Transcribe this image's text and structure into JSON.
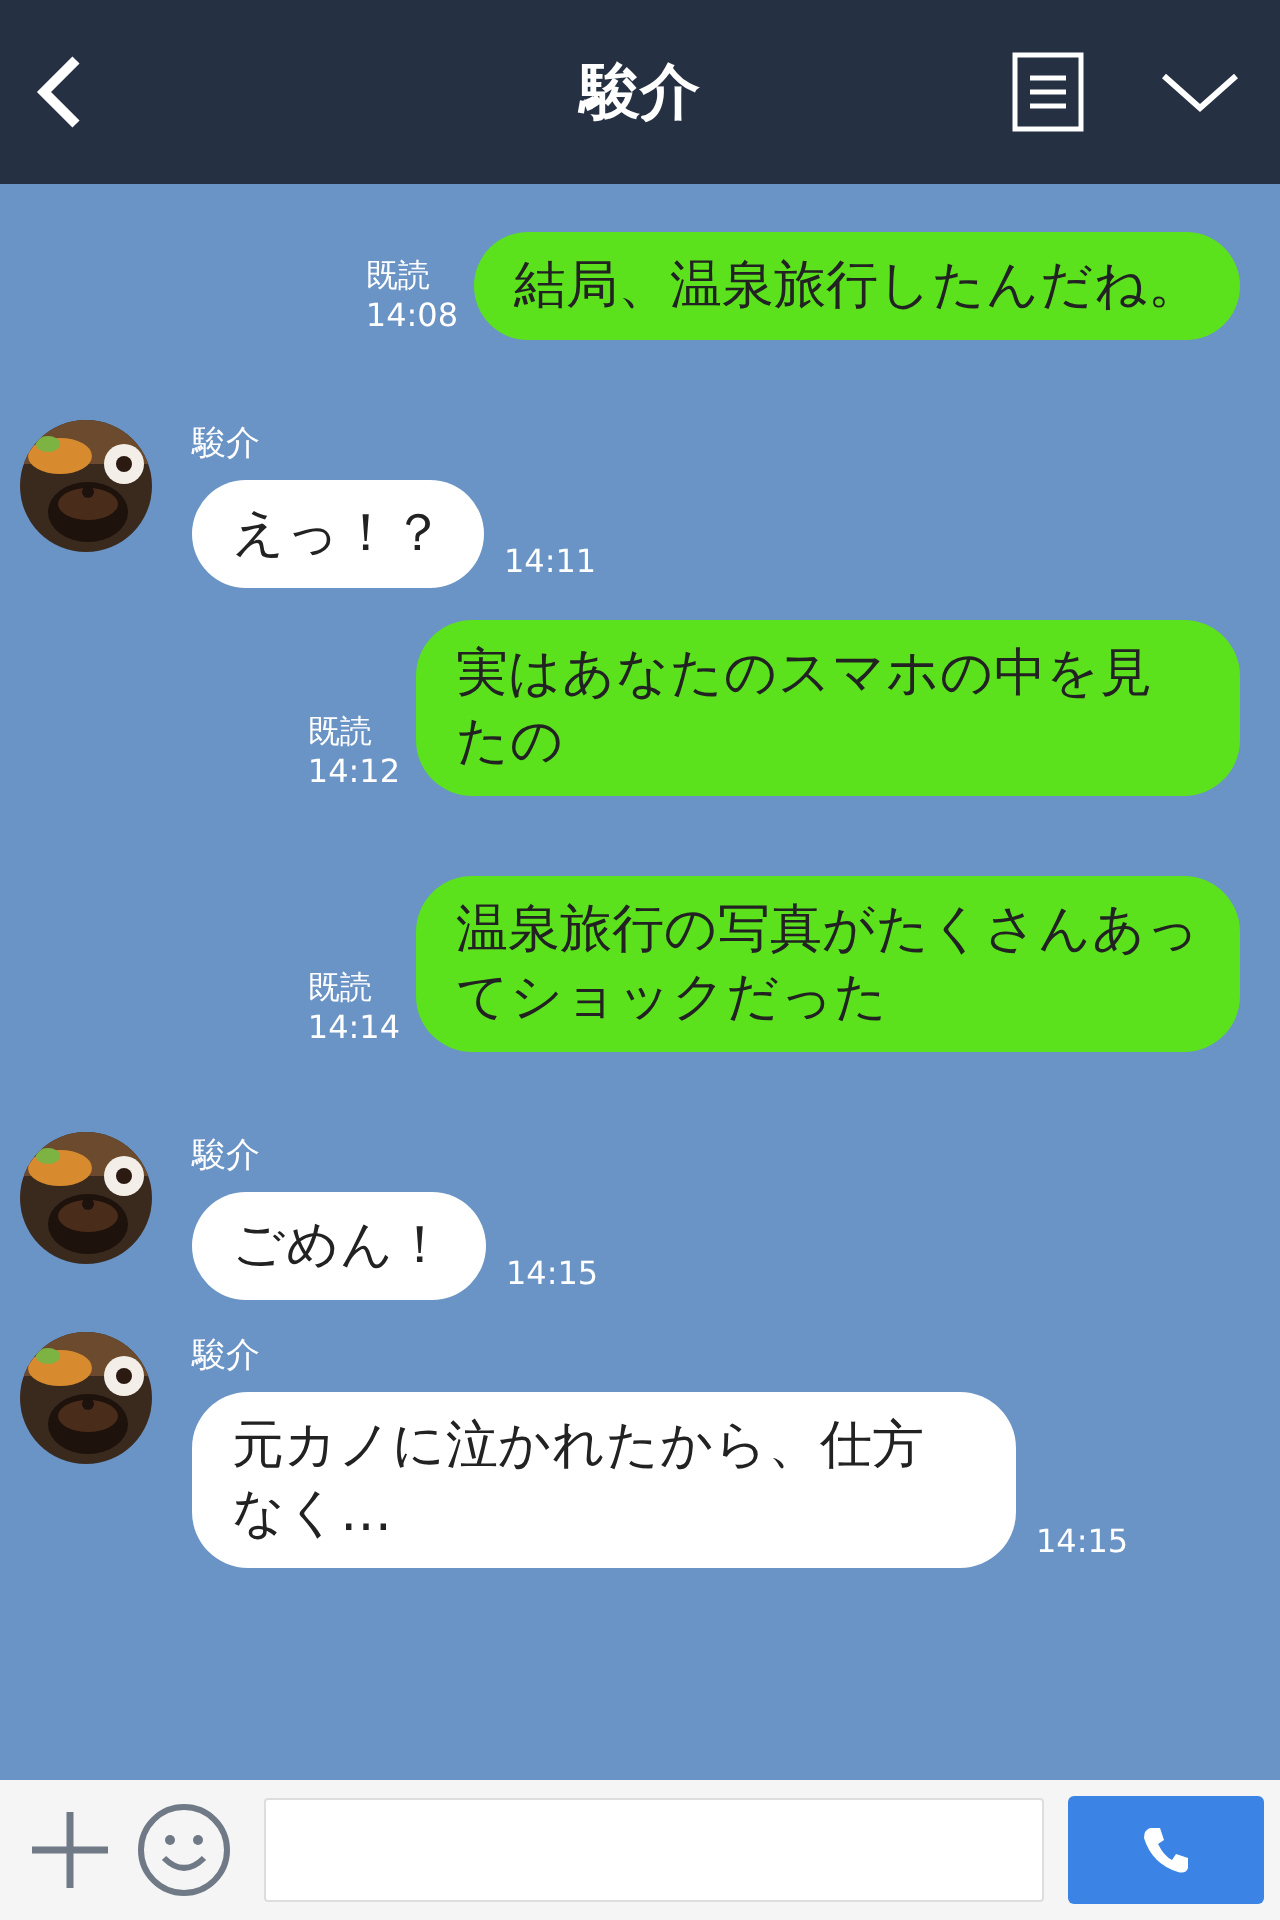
{
  "header": {
    "title": "駿介"
  },
  "messages": [
    {
      "kind": "sent",
      "text": "結局、温泉旅行したんだね。",
      "read": "既読",
      "time": "14:08"
    },
    {
      "kind": "received",
      "name": "駿介",
      "text": "えっ！？",
      "time": "14:11"
    },
    {
      "kind": "sent",
      "text": "実はあなたのスマホの中を見たの",
      "read": "既読",
      "time": "14:12"
    },
    {
      "kind": "sent",
      "text": "温泉旅行の写真がたくさんあってショックだった",
      "read": "既読",
      "time": "14:14"
    },
    {
      "kind": "received",
      "name": "駿介",
      "text": "ごめん！",
      "time": "14:15"
    },
    {
      "kind": "received",
      "name": "駿介",
      "text": "元カノに泣かれたから、仕方なく…",
      "time": "14:15"
    }
  ]
}
